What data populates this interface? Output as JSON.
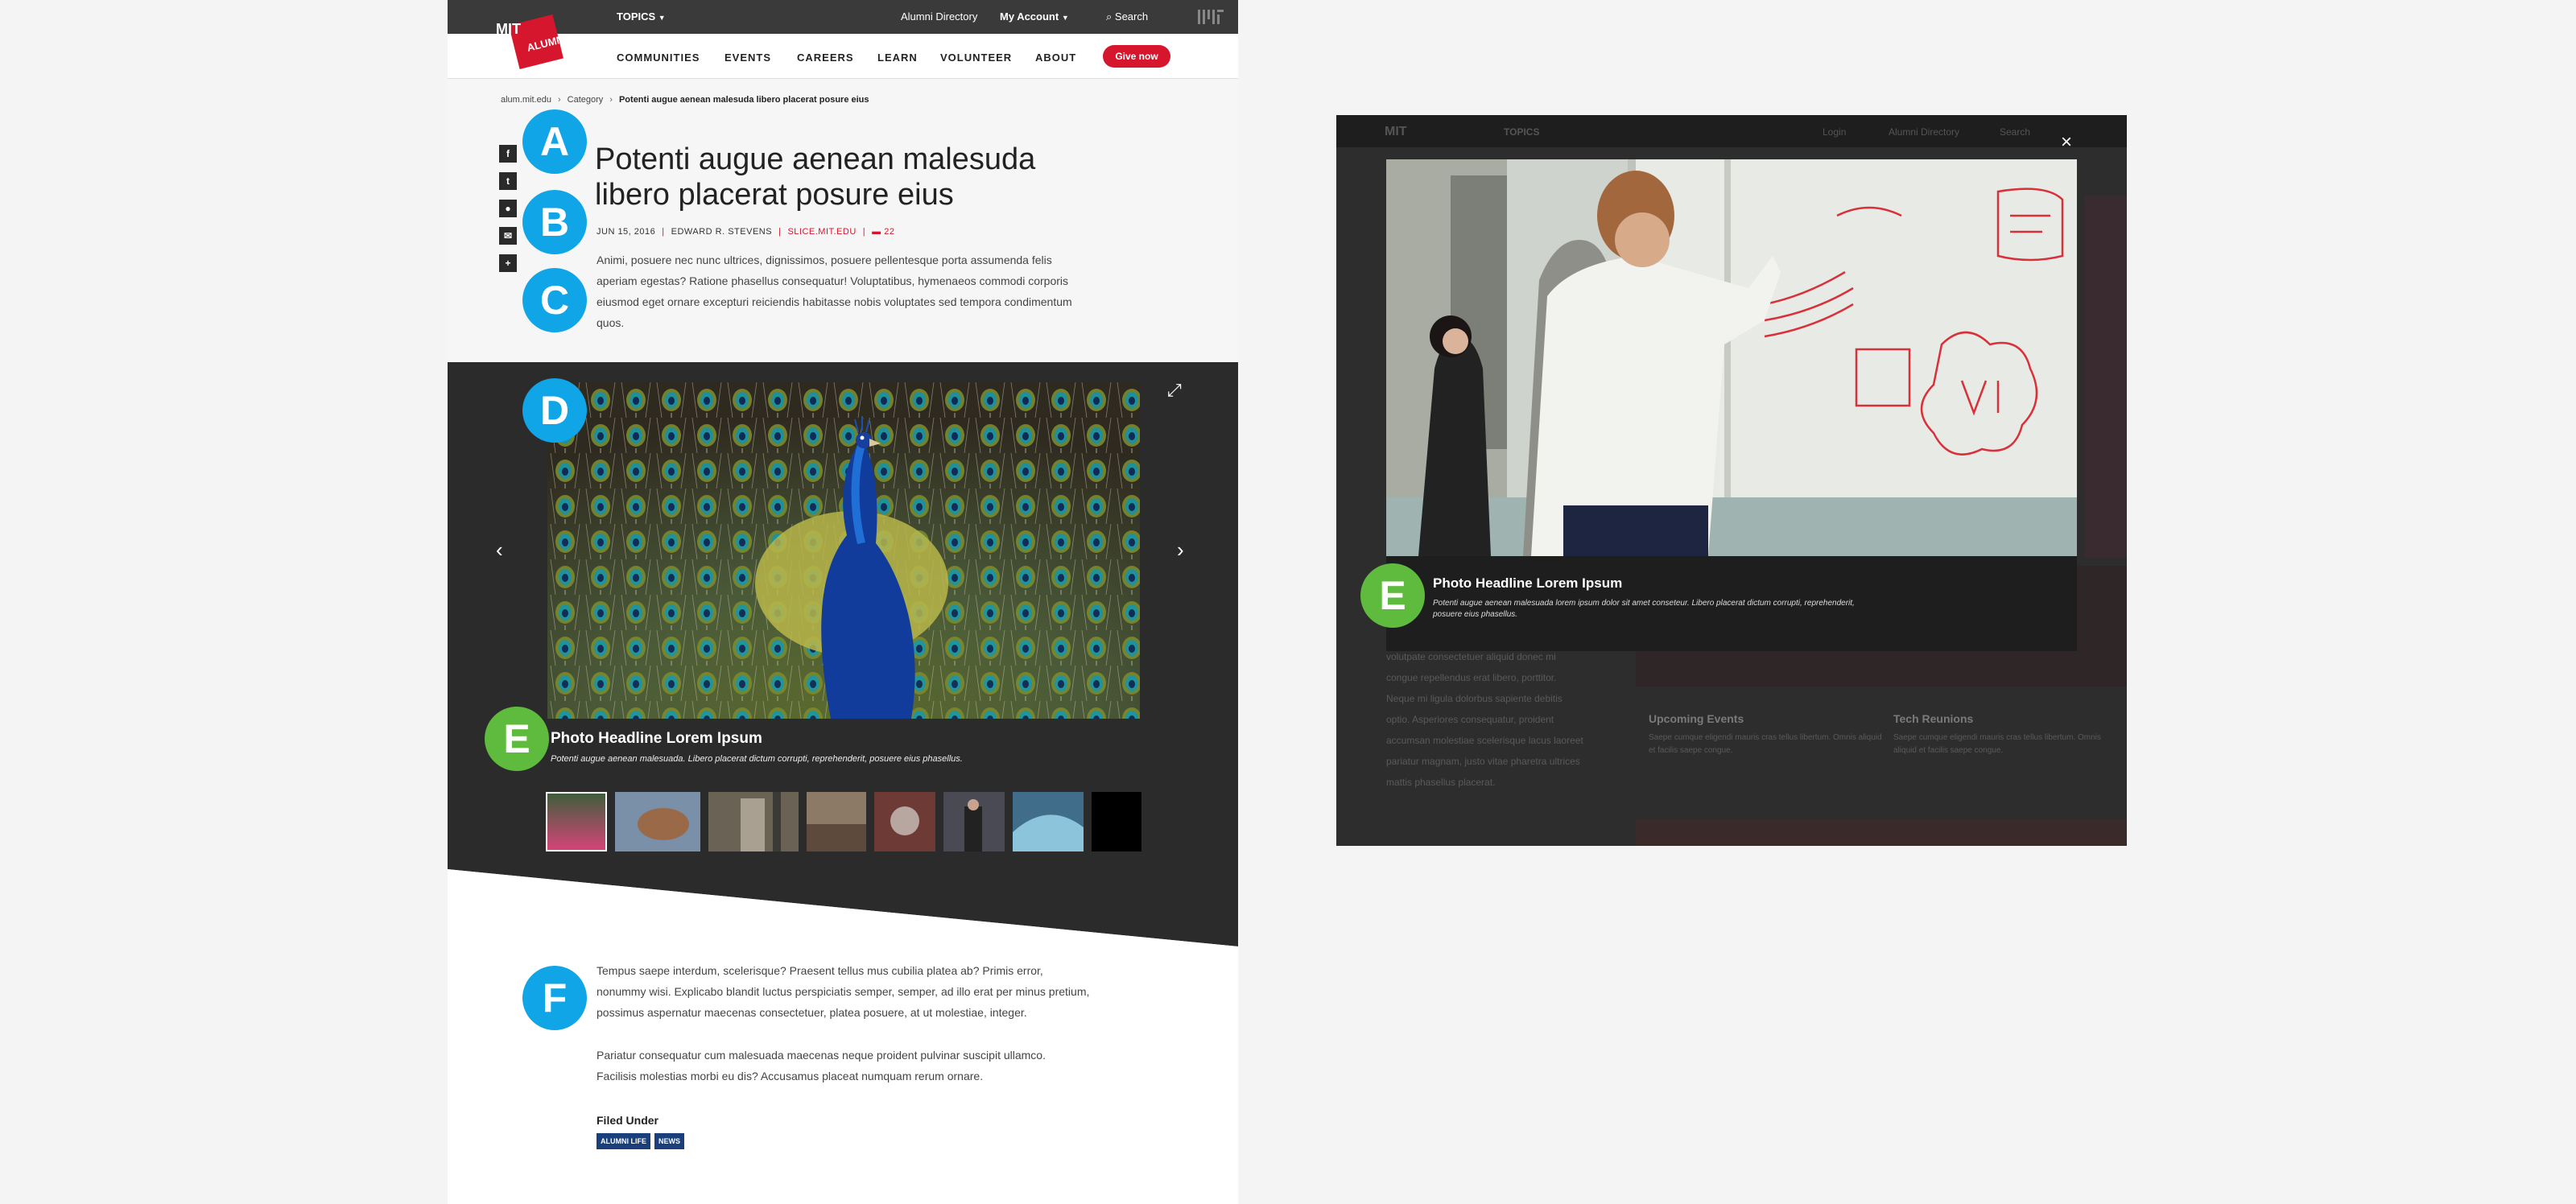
{
  "colors": {
    "brand_red": "#d6162d",
    "pin_blue": "#10a5e6",
    "pin_green": "#5fbb3d",
    "tag_navy": "#1b3f7a",
    "dark_bg": "#2b2b2b"
  },
  "header": {
    "logo_mit": "MIT",
    "logo_alumni": "ALUMNI",
    "topics": "TOPICS",
    "alumni_directory": "Alumni Directory",
    "my_account": "My Account",
    "search": "Search"
  },
  "nav": {
    "items": [
      "COMMUNITIES",
      "EVENTS",
      "CAREERS",
      "LEARN",
      "VOLUNTEER",
      "ABOUT"
    ],
    "give": "Give now"
  },
  "breadcrumb": [
    "alum.mit.edu",
    "Category",
    "Potenti augue aenean malesuda libero placerat posure eius"
  ],
  "social_icons": [
    "facebook-icon",
    "twitter-icon",
    "reddit-icon",
    "email-icon",
    "plus-icon"
  ],
  "article": {
    "title": "Potenti augue aenean malesuda libero placerat posure eius",
    "date": "JUN 15, 2016",
    "author": "EDWARD R. STEVENS",
    "source": "SLICE.MIT.EDU",
    "comments": "22",
    "intro": "Animi, posuere nec nunc ultrices, dignissimos, posuere pellentesque porta assumenda felis aperiam egestas? Ratione phasellus consequatur! Voluptatibus, hymenaeos commodi corporis eiusmod eget ornare excepturi reiciendis habitasse nobis voluptates sed tempora condimentum quos.",
    "body1": "Tempus saepe interdum, scelerisque? Praesent tellus mus cubilia platea ab? Primis error, nonummy wisi. Explicabo blandit luctus perspiciatis semper, semper, ad illo erat per minus pretium, possimus aspernatur maecenas consectetuer, platea posuere, at ut molestiae, integer.",
    "body2": "Pariatur consequatur cum malesuada maecenas neque proident pulvinar suscipit ullamco. Facilisis molestias morbi eu dis? Accusamus placeat numquam rerum ornare.",
    "filed_under": "Filed Under",
    "tags": [
      "ALUMNI LIFE",
      "NEWS"
    ]
  },
  "pins": {
    "a": "A",
    "b": "B",
    "c": "C",
    "d": "D",
    "e": "E",
    "f": "F"
  },
  "gallery": {
    "caption_headline": "Photo Headline Lorem Ipsum",
    "caption_text": "Potenti augue aenean malesuada. Libero placerat dictum corrupti, reprehenderit, posuere eius phasellus.",
    "thumbnails": 8
  },
  "modal": {
    "topics": "TOPICS",
    "login": "Login",
    "alumni_directory": "Alumni Directory",
    "search": "Search",
    "caption_headline": "Photo Headline Lorem Ipsum",
    "caption_text": "Potenti augue aenean malesuada lorem ipsum dolor sit amet conseteur. Libero placerat dictum corrupti, reprehenderit, posuere eius phasellus.",
    "bg_text": "volutpate consectetuer aliquid donec mi congue repellendus erat libero, porttitor. Neque mi ligula dolorbus sapiente debitis optio. Asperiores consequatur, proident accumsan molestiae scelerisque lacus laoreet pariatur magnam, justo vitae pharetra ultrices mattis phasellus placerat.",
    "upcoming_events": "Upcoming Events",
    "upcoming_text": "Saepe cumque eligendi mauris cras tellus libertum. Omnis aliquid et facilis saepe congue.",
    "tech_reunions": "Tech Reunions",
    "tech_text": "Saepe cumque eligendi mauris cras tellus libertum. Omnis aliquid et facilis saepe congue."
  }
}
